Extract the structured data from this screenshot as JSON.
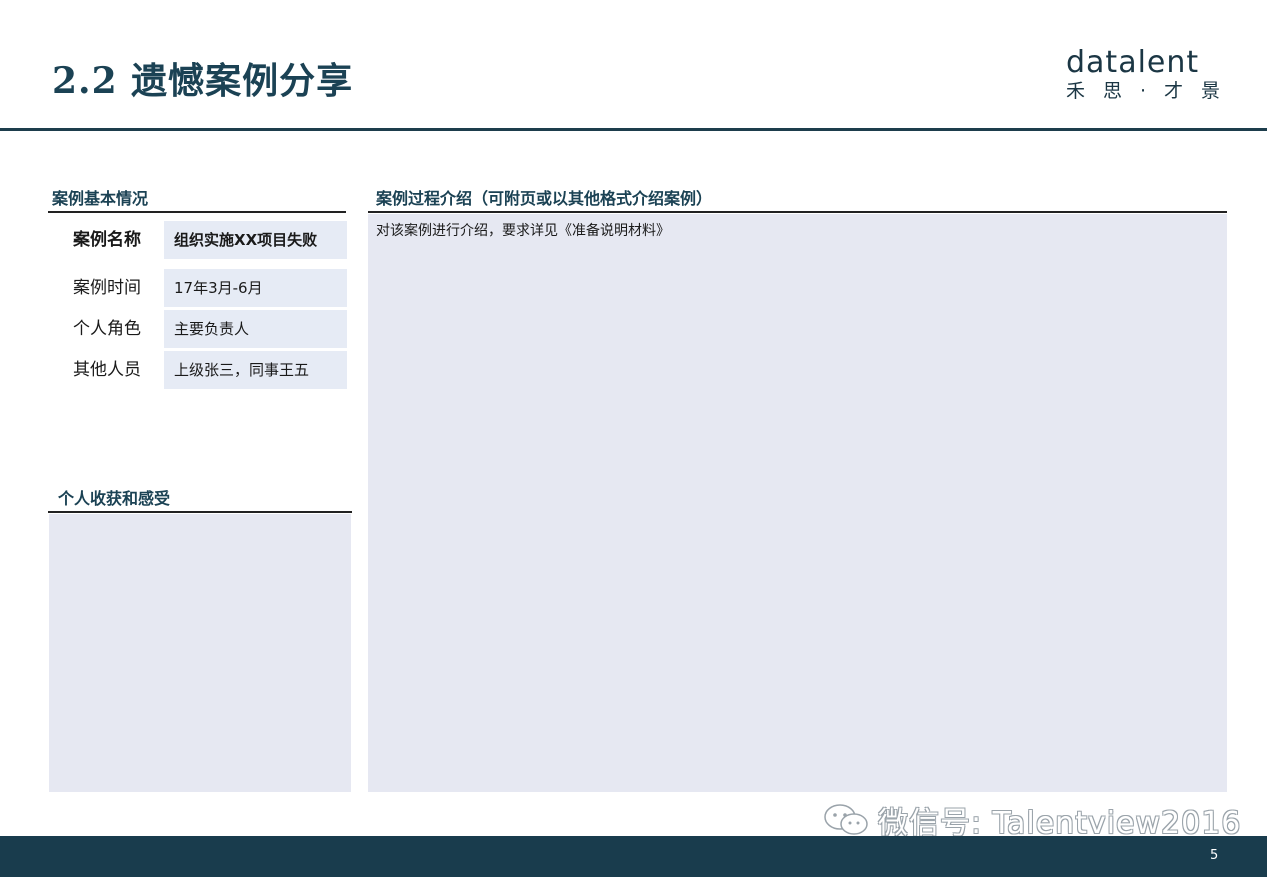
{
  "slide": {
    "title": "2.2 遗憾案例分享",
    "page_number": "5"
  },
  "logo": {
    "word": "datalent",
    "subtitle": "禾思·才景"
  },
  "basic_info": {
    "heading": "案例基本情况",
    "rows": [
      {
        "label": "案例名称",
        "value": "组织实施XX项目失败"
      },
      {
        "label": "案例时间",
        "value": "17年3月-6月"
      },
      {
        "label": "个人角色",
        "value": "主要负责人"
      },
      {
        "label": "其他人员",
        "value": "上级张三，同事王五"
      }
    ]
  },
  "gains": {
    "heading": "个人收获和感受"
  },
  "process": {
    "heading": "案例过程介绍（可附页或以其他格式介绍案例）",
    "body": "对该案例进行介绍，要求详见《准备说明材料》"
  },
  "watermark": {
    "text": "微信号: Talentview2016"
  },
  "colors": {
    "title": "#1b4254",
    "footer": "#193c4d",
    "panel": "#e6e8f2",
    "cell": "#e6ebf5",
    "logo_dot": "#e49a34"
  }
}
